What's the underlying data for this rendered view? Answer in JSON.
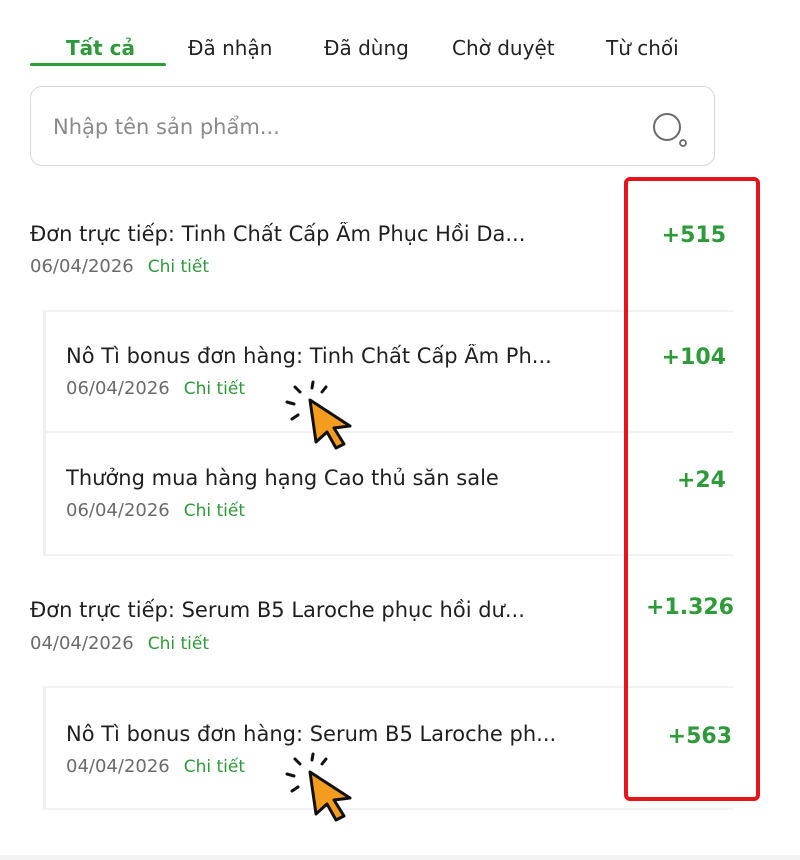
{
  "tabs": [
    {
      "label": "Tất cả",
      "active": true
    },
    {
      "label": "Đã nhận",
      "active": false
    },
    {
      "label": "Đã dùng",
      "active": false
    },
    {
      "label": "Chờ duyệt",
      "active": false
    },
    {
      "label": "Từ chối",
      "active": false
    }
  ],
  "search": {
    "placeholder": "Nhập tên sản phẩm...",
    "value": "",
    "icon": "search-icon"
  },
  "orders": [
    {
      "title": "Đơn trực tiếp: Tinh Chất Cấp Ẩm Phục Hồi Da...",
      "date": "06/04/2026",
      "detail_label": "Chi tiết",
      "amount": "+515",
      "children": [
        {
          "title": "Nô Tì bonus đơn hàng: Tinh Chất Cấp Ẩm Ph...",
          "date": "06/04/2026",
          "detail_label": "Chi tiết",
          "amount": "+104"
        },
        {
          "title": "Thưởng mua hàng hạng Cao thủ săn sale",
          "date": "06/04/2026",
          "detail_label": "Chi tiết",
          "amount": "+24"
        }
      ]
    },
    {
      "title": "Đơn trực tiếp: Serum B5 Laroche phục hồi dư...",
      "date": "04/04/2026",
      "detail_label": "Chi tiết",
      "amount": "+1.326",
      "children": [
        {
          "title": "Nô Tì bonus đơn hàng: Serum B5 Laroche ph...",
          "date": "04/04/2026",
          "detail_label": "Chi tiết",
          "amount": "+563"
        }
      ]
    }
  ],
  "colors": {
    "accent": "#2e9a3a",
    "highlight": "#e3141b",
    "cursor": "#f39c1e"
  }
}
